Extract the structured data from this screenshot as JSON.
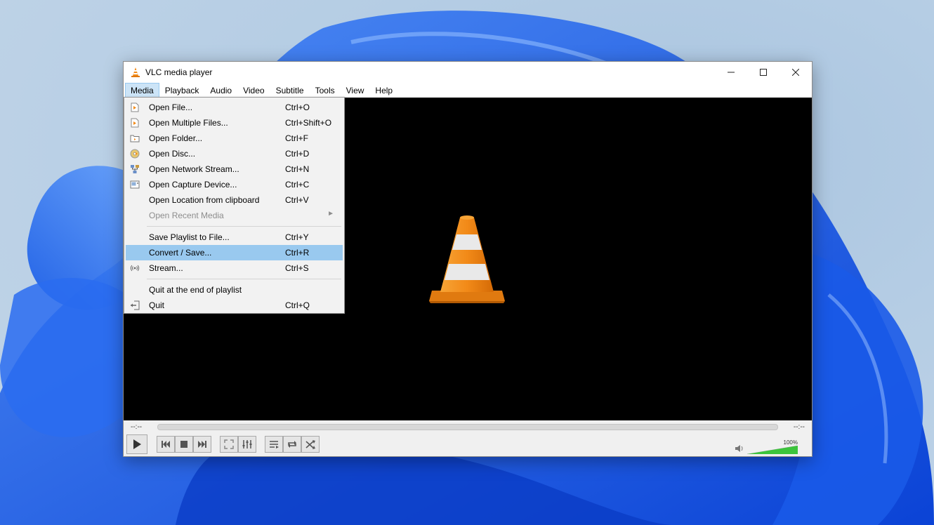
{
  "window": {
    "title": "VLC media player"
  },
  "menubar": {
    "items": [
      "Media",
      "Playback",
      "Audio",
      "Video",
      "Subtitle",
      "Tools",
      "View",
      "Help"
    ],
    "active": "Media"
  },
  "media_menu": {
    "items": [
      {
        "label": "Open File...",
        "shortcut": "Ctrl+O",
        "icon": "file-icon"
      },
      {
        "label": "Open Multiple Files...",
        "shortcut": "Ctrl+Shift+O",
        "icon": "multiple-files-icon"
      },
      {
        "label": "Open Folder...",
        "shortcut": "Ctrl+F",
        "icon": "folder-icon"
      },
      {
        "label": "Open Disc...",
        "shortcut": "Ctrl+D",
        "icon": "disc-icon"
      },
      {
        "label": "Open Network Stream...",
        "shortcut": "Ctrl+N",
        "icon": "network-icon"
      },
      {
        "label": "Open Capture Device...",
        "shortcut": "Ctrl+C",
        "icon": "capture-device-icon"
      },
      {
        "label": "Open Location from clipboard",
        "shortcut": "Ctrl+V"
      },
      {
        "label": "Open Recent Media",
        "shortcut": "",
        "disabled": true,
        "submenu": true
      },
      {
        "label": "Save Playlist to File...",
        "shortcut": "Ctrl+Y"
      },
      {
        "label": "Convert / Save...",
        "shortcut": "Ctrl+R",
        "highlighted": true
      },
      {
        "label": "Stream...",
        "shortcut": "Ctrl+S",
        "icon": "stream-icon"
      },
      {
        "label": "Quit at the end of playlist",
        "shortcut": ""
      },
      {
        "label": "Quit",
        "shortcut": "Ctrl+Q",
        "icon": "quit-icon"
      }
    ]
  },
  "controls": {
    "time_elapsed": "--:--",
    "time_total": "--:--",
    "volume_label": "100%",
    "volume_fraction": 1.0
  },
  "colors": {
    "highlight": "#99c9ef",
    "menu_active": "#cce4f7",
    "cone_orange": "#f28a18",
    "volume_green": "#3cc43c"
  }
}
